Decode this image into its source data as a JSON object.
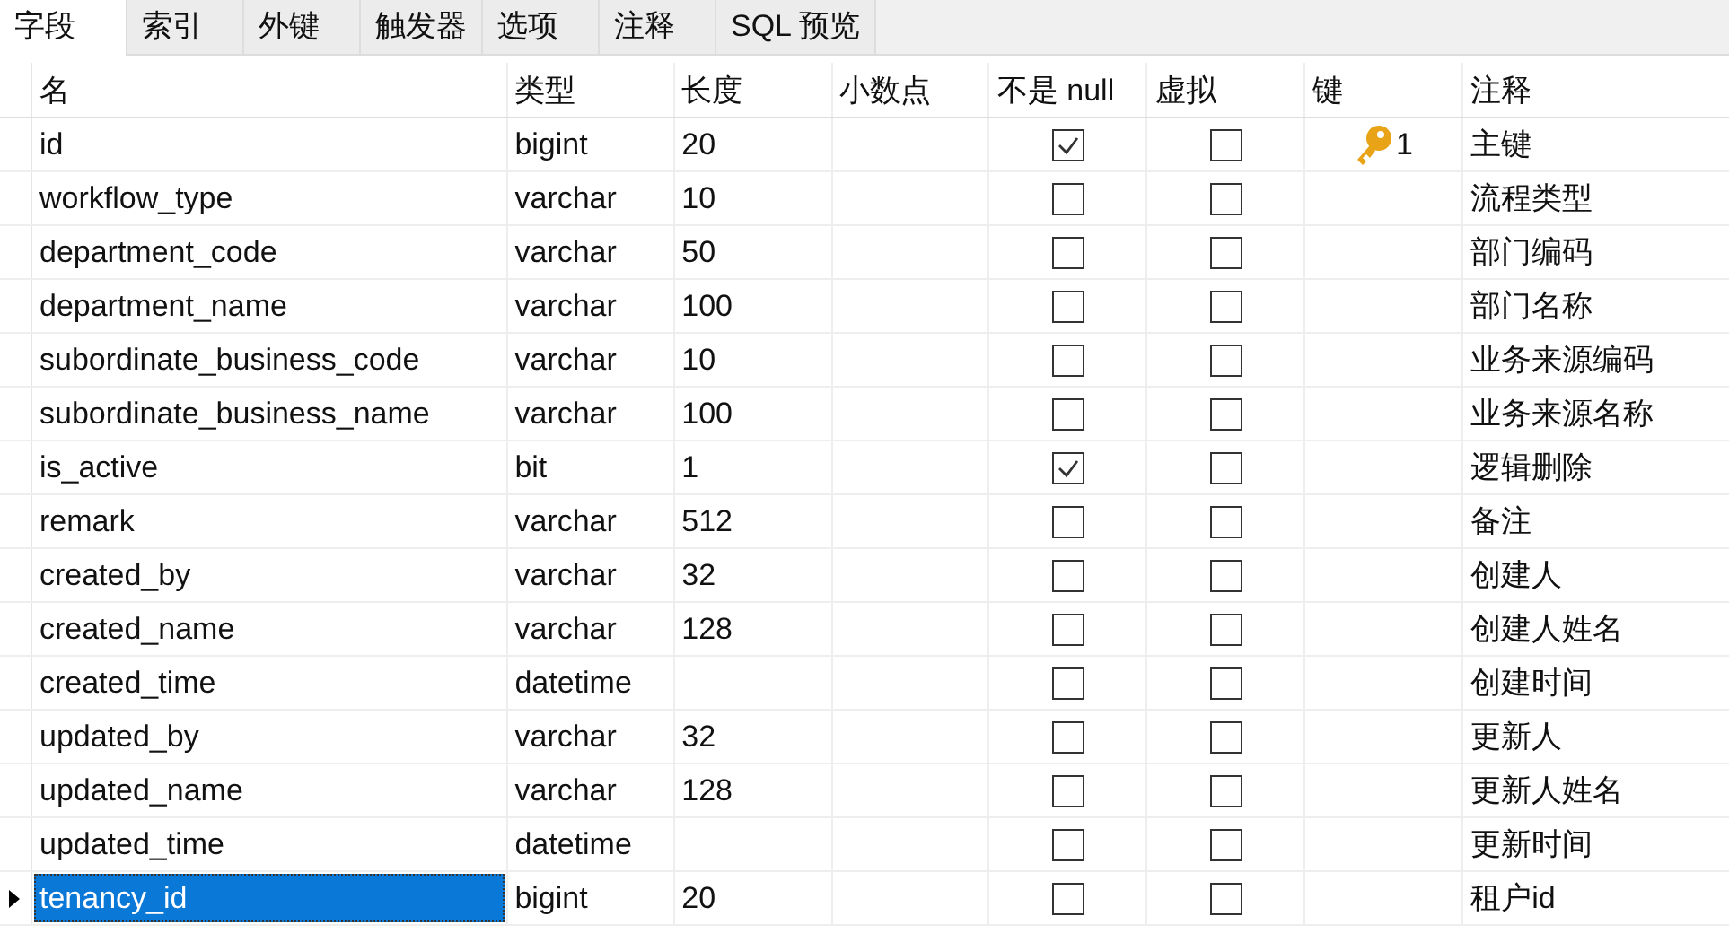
{
  "tabs": [
    {
      "label": "字段",
      "selected": true
    },
    {
      "label": "索引",
      "selected": false
    },
    {
      "label": "外键",
      "selected": false
    },
    {
      "label": "触发器",
      "selected": false
    },
    {
      "label": "选项",
      "selected": false
    },
    {
      "label": "注释",
      "selected": false
    },
    {
      "label": "SQL 预览",
      "selected": false
    }
  ],
  "table": {
    "columns": [
      "名",
      "类型",
      "长度",
      "小数点",
      "不是 null",
      "虚拟",
      "键",
      "注释"
    ],
    "rows": [
      {
        "name": "id",
        "type": "bigint",
        "length": "20",
        "not_null": true,
        "virtual": false,
        "key": "1",
        "comment": "主键",
        "selected": false
      },
      {
        "name": "workflow_type",
        "type": "varchar",
        "length": "10",
        "not_null": false,
        "virtual": false,
        "comment": "流程类型",
        "selected": false
      },
      {
        "name": "department_code",
        "type": "varchar",
        "length": "50",
        "not_null": false,
        "virtual": false,
        "comment": "部门编码",
        "selected": false
      },
      {
        "name": "department_name",
        "type": "varchar",
        "length": "100",
        "not_null": false,
        "virtual": false,
        "comment": "部门名称",
        "selected": false
      },
      {
        "name": "subordinate_business_code",
        "type": "varchar",
        "length": "10",
        "not_null": false,
        "virtual": false,
        "comment": "业务来源编码",
        "selected": false
      },
      {
        "name": "subordinate_business_name",
        "type": "varchar",
        "length": "100",
        "not_null": false,
        "virtual": false,
        "comment": "业务来源名称",
        "selected": false
      },
      {
        "name": "is_active",
        "type": "bit",
        "length": "1",
        "not_null": true,
        "virtual": false,
        "comment": "逻辑删除",
        "selected": false
      },
      {
        "name": "remark",
        "type": "varchar",
        "length": "512",
        "not_null": false,
        "virtual": false,
        "comment": "备注",
        "selected": false
      },
      {
        "name": "created_by",
        "type": "varchar",
        "length": "32",
        "not_null": false,
        "virtual": false,
        "comment": "创建人",
        "selected": false
      },
      {
        "name": "created_name",
        "type": "varchar",
        "length": "128",
        "not_null": false,
        "virtual": false,
        "comment": "创建人姓名",
        "selected": false
      },
      {
        "name": "created_time",
        "type": "datetime",
        "not_null": false,
        "virtual": false,
        "comment": "创建时间",
        "selected": false
      },
      {
        "name": "updated_by",
        "type": "varchar",
        "length": "32",
        "not_null": false,
        "virtual": false,
        "comment": "更新人",
        "selected": false
      },
      {
        "name": "updated_name",
        "type": "varchar",
        "length": "128",
        "not_null": false,
        "virtual": false,
        "comment": "更新人姓名",
        "selected": false
      },
      {
        "name": "updated_time",
        "type": "datetime",
        "not_null": false,
        "virtual": false,
        "comment": "更新时间",
        "selected": false
      },
      {
        "name": "tenancy_id",
        "type": "bigint",
        "length": "20",
        "not_null": false,
        "virtual": false,
        "comment": "租户id",
        "selected": true
      }
    ]
  }
}
